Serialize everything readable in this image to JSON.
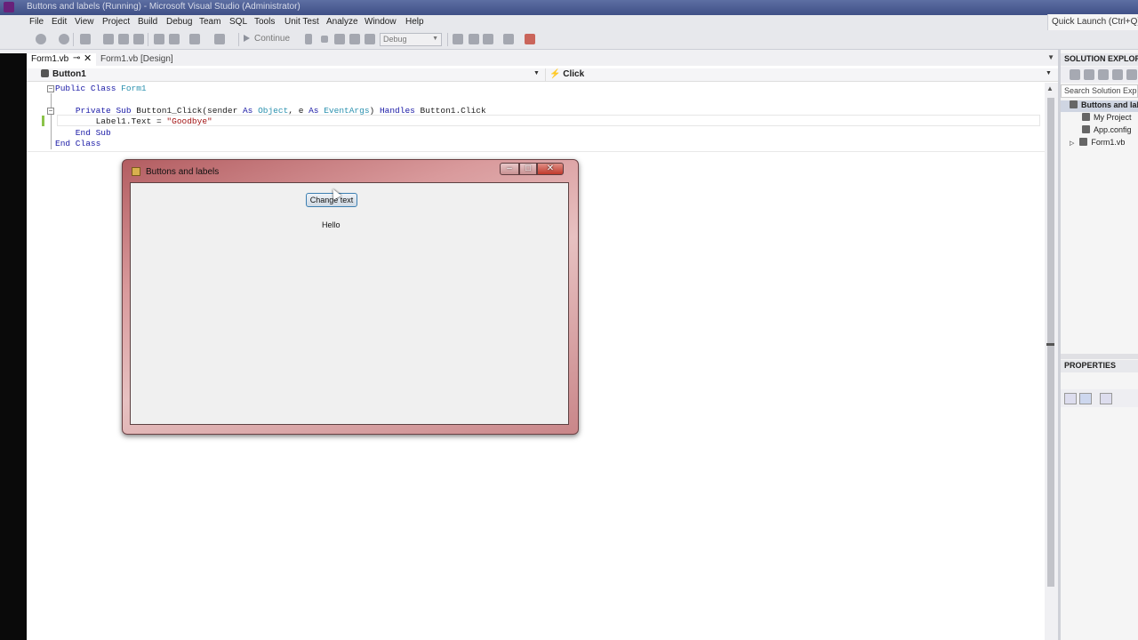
{
  "window": {
    "title": "Buttons and labels (Running) - Microsoft Visual Studio (Administrator)"
  },
  "menubar": {
    "items": [
      "File",
      "Edit",
      "View",
      "Project",
      "Build",
      "Debug",
      "Team",
      "SQL",
      "Tools",
      "Unit Test",
      "Analyze",
      "Window",
      "Help"
    ],
    "quick_launch": "Quick Launch (Ctrl+Q)"
  },
  "toolbar": {
    "continue_label": "Continue",
    "configuration": "Debug"
  },
  "tabs": [
    {
      "label": "Form1.vb",
      "active": true
    },
    {
      "label": "Form1.vb [Design]",
      "active": false
    }
  ],
  "navbar": {
    "object": "Button1",
    "event": "Click"
  },
  "code_lines": [
    "Public Class Form1",
    "",
    "    Private Sub Button1_Click(sender As Object, e As EventArgs) Handles Button1.Click",
    "        Label1.Text = \"Goodbye\"",
    "    End Sub",
    "End Class"
  ],
  "solution_explorer": {
    "header": "SOLUTION EXPLORER",
    "search_placeholder": "Search Solution Explorer",
    "root": "Buttons and labels",
    "items": [
      "My Project",
      "App.config",
      "Form1.vb"
    ]
  },
  "properties": {
    "header": "PROPERTIES"
  },
  "running_app": {
    "title": "Buttons and labels",
    "button_label": "Change text",
    "label_text": "Hello"
  },
  "colors": {
    "keyword": "#1a1aa6",
    "type": "#2b91af",
    "string": "#a31515",
    "accent": "#68217a"
  }
}
